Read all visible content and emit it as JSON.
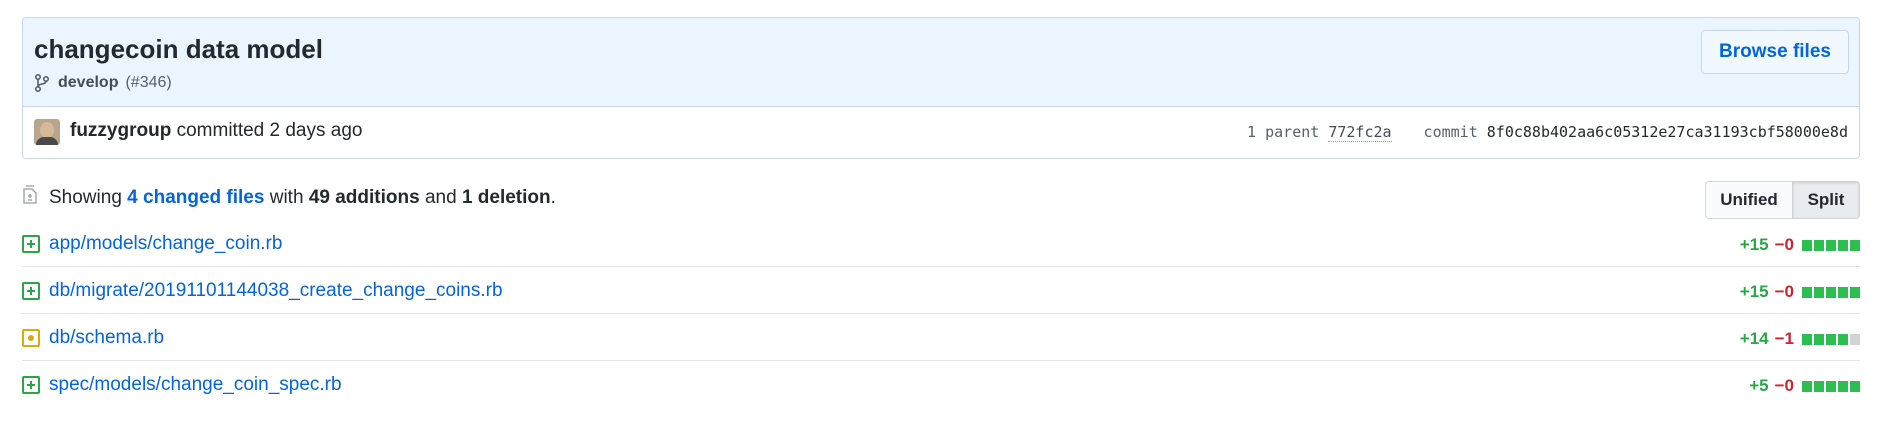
{
  "commit": {
    "title": "changecoin data model",
    "branch": "develop",
    "pr_ref": "(#346)",
    "browse_label": "Browse files",
    "author": "fuzzygroup",
    "committed_text": "committed 2 days ago",
    "parent_label": "1 parent",
    "parent_sha": "772fc2a",
    "commit_label": "commit",
    "commit_sha": "8f0c88b402aa6c05312e27ca31193cbf58000e8d"
  },
  "toc": {
    "showing": "Showing",
    "changed_files": "4 changed files",
    "with": "with",
    "additions": "49 additions",
    "and": "and",
    "deletions": "1 deletion",
    "period": ".",
    "unified_label": "Unified",
    "split_label": "Split",
    "selected_view": "Split"
  },
  "files": [
    {
      "status": "added",
      "name": "app/models/change_coin.rb",
      "additions": "+15",
      "deletions": "−0",
      "blocks": [
        "add",
        "add",
        "add",
        "add",
        "add"
      ]
    },
    {
      "status": "added",
      "name": "db/migrate/20191101144038_create_change_coins.rb",
      "additions": "+15",
      "deletions": "−0",
      "blocks": [
        "add",
        "add",
        "add",
        "add",
        "add"
      ]
    },
    {
      "status": "modified",
      "name": "db/schema.rb",
      "additions": "+14",
      "deletions": "−1",
      "blocks": [
        "add",
        "add",
        "add",
        "add",
        "neutral"
      ]
    },
    {
      "status": "added",
      "name": "spec/models/change_coin_spec.rb",
      "additions": "+5",
      "deletions": "−0",
      "blocks": [
        "add",
        "add",
        "add",
        "add",
        "add"
      ]
    }
  ],
  "colors": {
    "link": "#0366d6",
    "addition": "#28a745",
    "deletion": "#cb2431",
    "modified": "#dbab09",
    "header_bg": "#eaf5ff"
  }
}
